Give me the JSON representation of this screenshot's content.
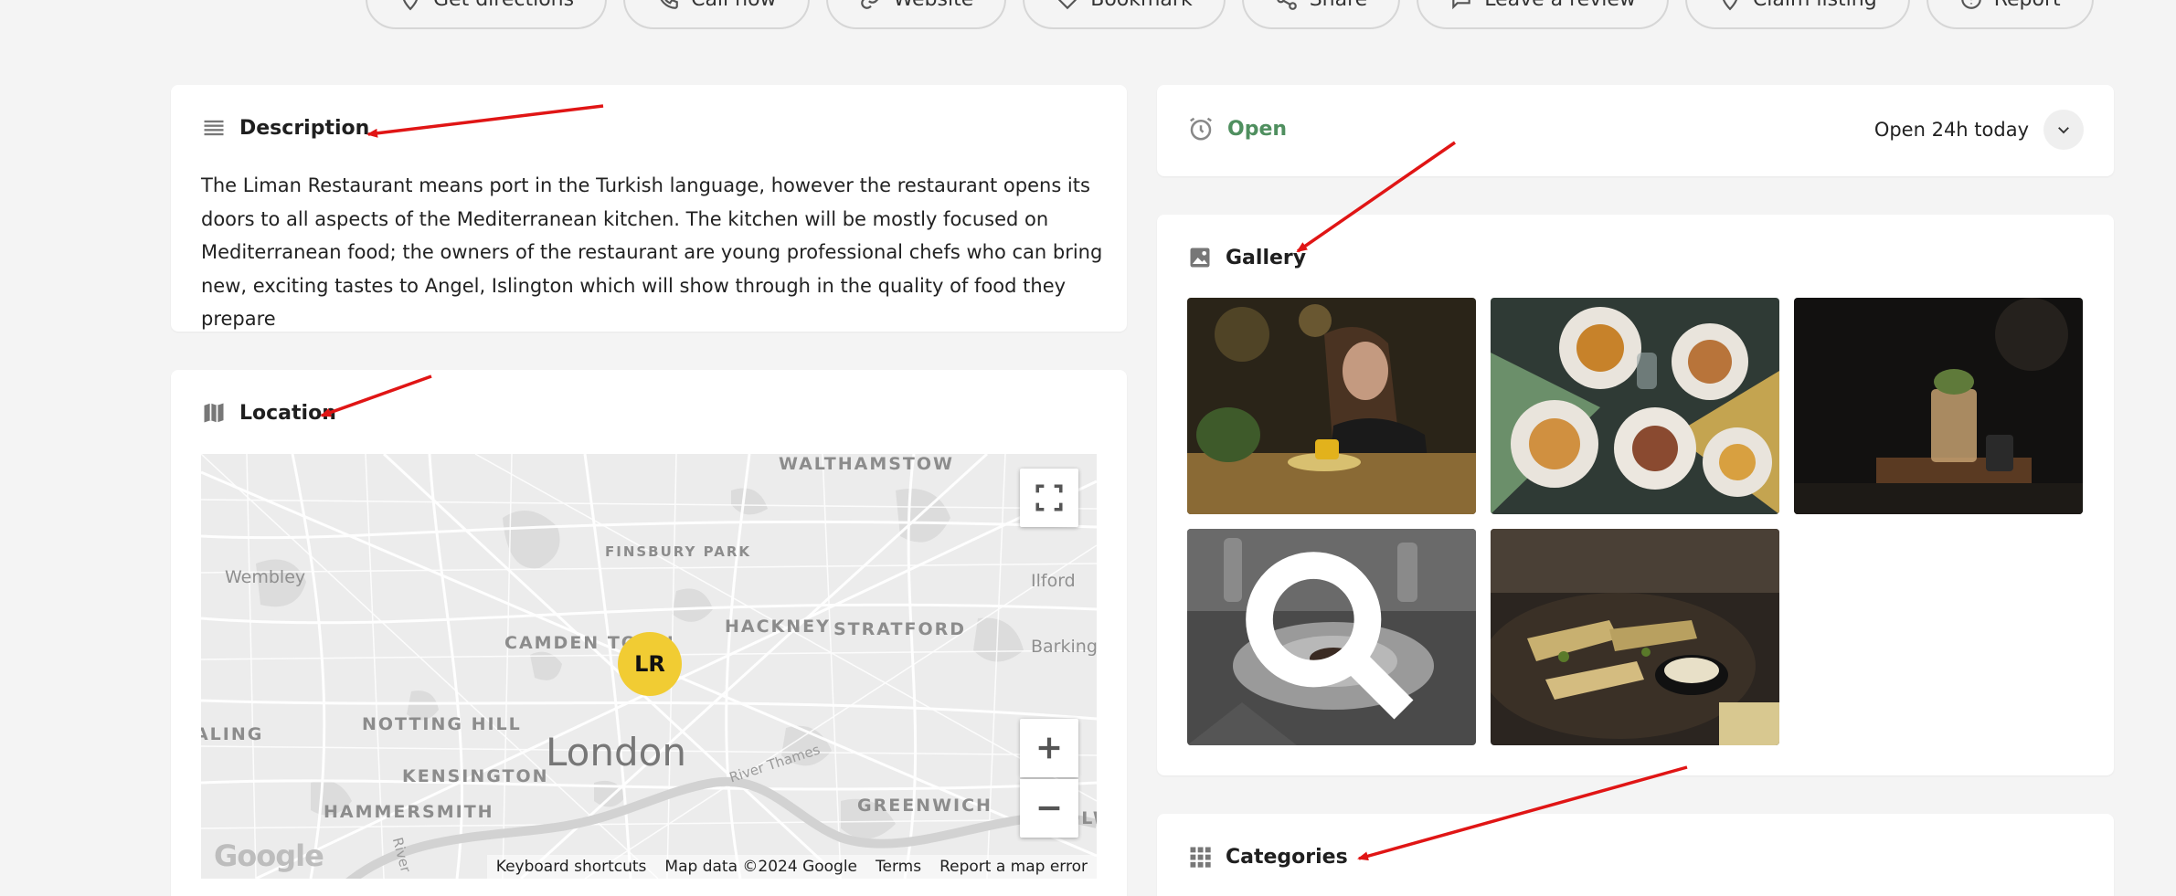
{
  "actions": [
    {
      "label": "Get directions",
      "icon": "map-pin-icon"
    },
    {
      "label": "Call now",
      "icon": "phone-icon"
    },
    {
      "label": "Website",
      "icon": "link-icon"
    },
    {
      "label": "Bookmark",
      "icon": "heart-icon"
    },
    {
      "label": "Share",
      "icon": "share-icon"
    },
    {
      "label": "Leave a review",
      "icon": "chat-icon"
    },
    {
      "label": "Claim listing",
      "icon": "map-pin-icon"
    },
    {
      "label": "Report",
      "icon": "alert-icon"
    }
  ],
  "description": {
    "title": "Description",
    "text": "The Liman Restaurant means port in the Turkish language, however the restaurant opens its doors to all aspects of the Mediterranean kitchen. The kitchen will be mostly focused on Mediterranean food; the owners of the restaurant are young professional chefs who can bring new, exciting tastes to Angel, Islington which will show through in the quality of food they prepare"
  },
  "location": {
    "title": "Location",
    "map": {
      "labels": {
        "walthamstow": "WALTHAMSTOW",
        "finsbury_park": "FINSBURY PARK",
        "wembley": "Wembley",
        "ilford": "Ilford",
        "camden_town": "CAMDEN TOWN",
        "hackney": "HACKNEY",
        "stratford": "STRATFORD",
        "barking": "Barking",
        "ealing": "EALING",
        "notting_hill": "NOTTING HILL",
        "london": "London",
        "kensington": "KENSINGTON",
        "hammersmith": "HAMMERSMITH",
        "greenwich": "GREENWICH",
        "woolwich": "WOOLWICH",
        "river_thames": "River Thames",
        "river": "River"
      },
      "marker_text": "LR",
      "google_logo": "Google",
      "footer": {
        "shortcuts": "Keyboard shortcuts",
        "map_data": "Map data ©2024 Google",
        "terms": "Terms",
        "report": "Report a map error"
      }
    }
  },
  "hours": {
    "status": "Open",
    "summary": "Open 24h today",
    "status_color": "#4f8f5f"
  },
  "gallery": {
    "title": "Gallery",
    "images": [
      {
        "alt": "woman-dining-photo"
      },
      {
        "alt": "table-food-plates-photo"
      },
      {
        "alt": "cocktail-photo"
      },
      {
        "alt": "plated-dish-photo"
      },
      {
        "alt": "grilled-food-photo"
      }
    ]
  },
  "categories": {
    "title": "Categories"
  },
  "colors": {
    "accent_marker": "#f1cc33",
    "annotation_arrow": "#e01515",
    "open_green": "#4f8f5f"
  }
}
